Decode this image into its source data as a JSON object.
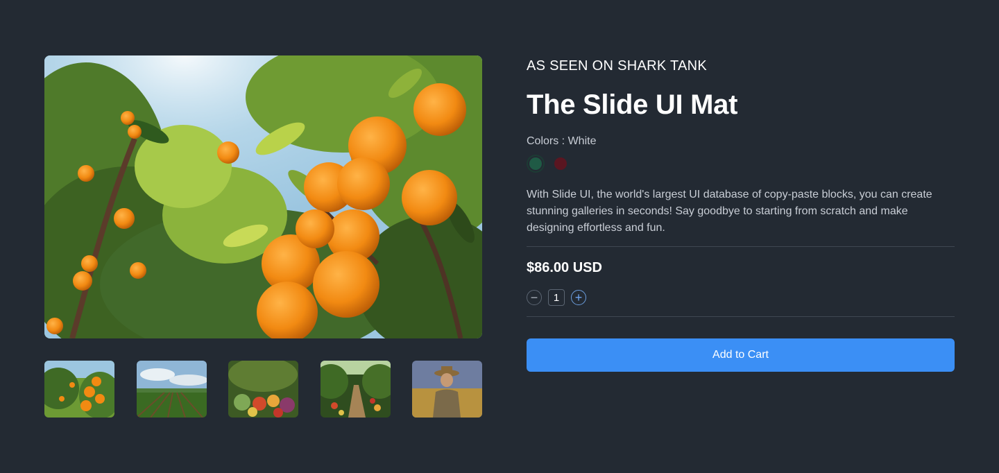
{
  "gallery": {
    "hero_image": "orange-tree-image",
    "thumbnails": [
      {
        "name": "orange-tree-thumb"
      },
      {
        "name": "farm-field-thumb"
      },
      {
        "name": "vegetables-thumb"
      },
      {
        "name": "garden-path-thumb"
      },
      {
        "name": "farmer-thumb"
      }
    ]
  },
  "product": {
    "eyebrow": "AS SEEN ON SHARK TANK",
    "title": "The Slide UI Mat",
    "colors_label": "Colors : White",
    "colors": [
      {
        "name": "White",
        "hex": "#1f5a45",
        "selected": true
      },
      {
        "name": "Red",
        "hex": "#5a1621",
        "selected": false
      }
    ],
    "description": "With Slide UI, the world's largest UI database of copy-paste blocks, you can create stunning galleries in seconds! Say goodbye to starting from scratch and make designing effortless and fun.",
    "price": "$86.00 USD",
    "quantity": "1",
    "add_to_cart_label": "Add to Cart"
  },
  "colors": {
    "background": "#232a33",
    "accent": "#3b8ff5",
    "divider": "#3f4752"
  }
}
